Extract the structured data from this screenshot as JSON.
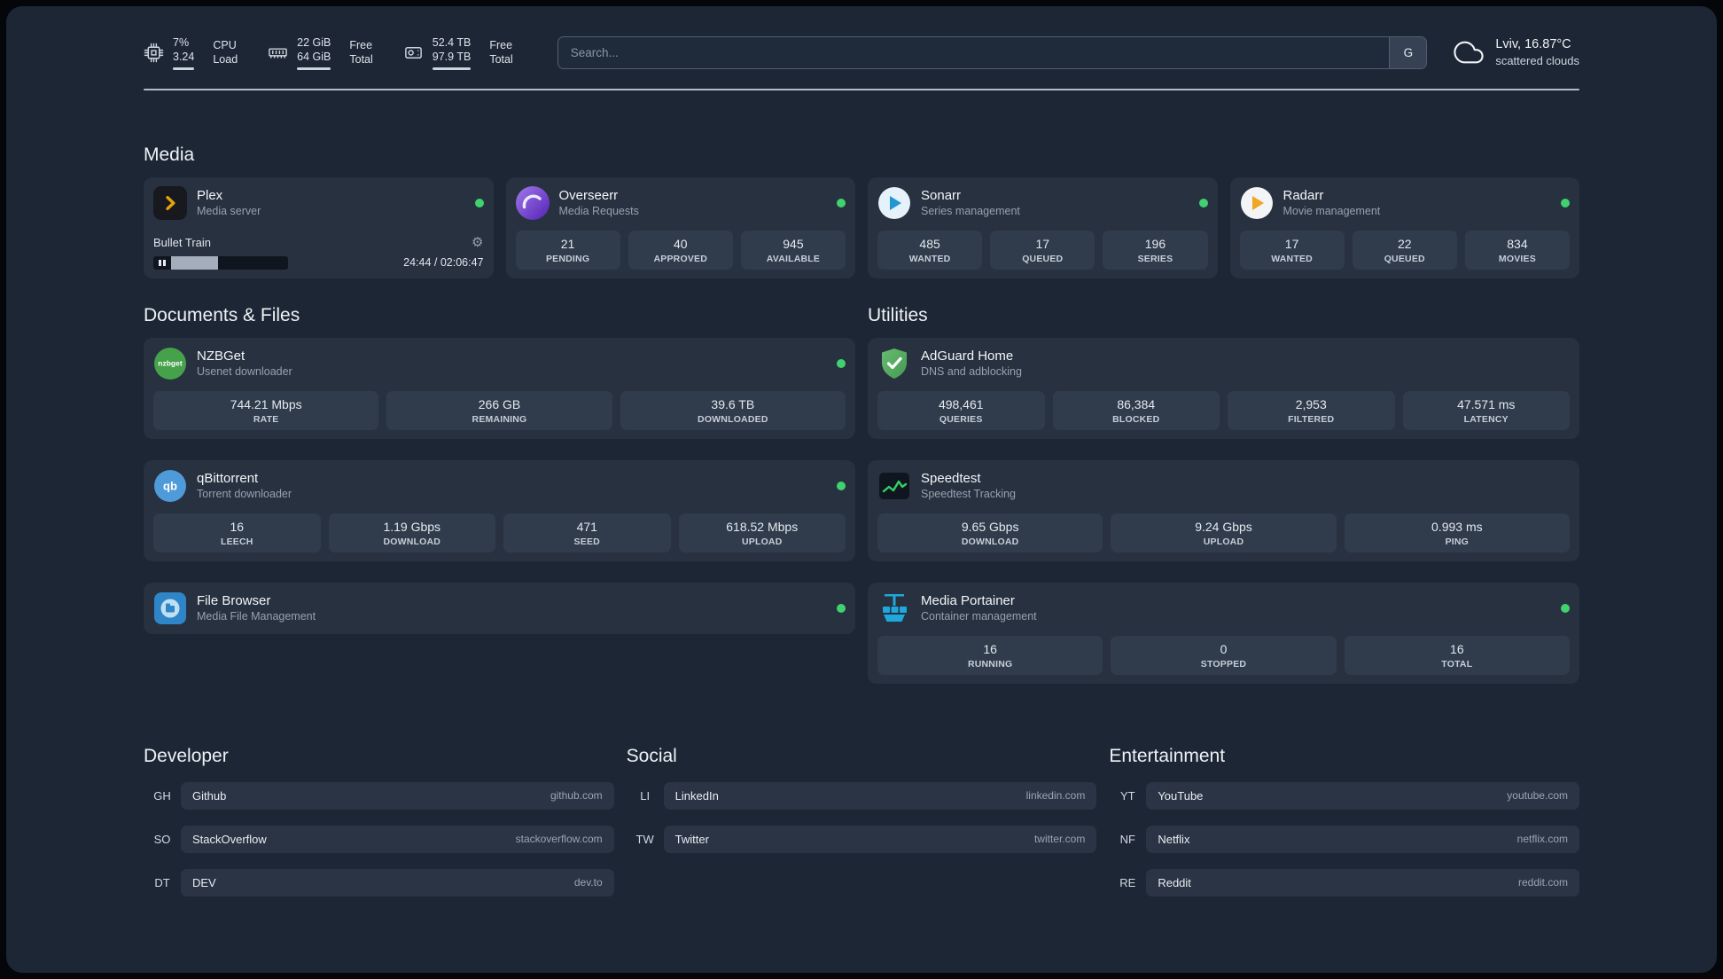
{
  "icons": {
    "gear": "⚙",
    "nzbget_logo_text": "nzbget",
    "qbittorrent_logo_text": "qb"
  },
  "topbar": {
    "cpu": {
      "percent": "7%",
      "load": "3.24",
      "label_top": "CPU",
      "label_bottom": "Load"
    },
    "memory": {
      "free": "22 GiB",
      "total": "64 GiB",
      "label_top": "Free",
      "label_bottom": "Total"
    },
    "disk": {
      "free": "52.4 TB",
      "total": "97.9 TB",
      "label_top": "Free",
      "label_bottom": "Total"
    },
    "search": {
      "placeholder": "Search...",
      "provider_label": "G"
    },
    "weather": {
      "location": "Lviv, 16.87°C",
      "condition": "scattered clouds"
    }
  },
  "sections": {
    "media": "Media",
    "documents": "Documents & Files",
    "utilities": "Utilities",
    "developer": "Developer",
    "social": "Social",
    "entertainment": "Entertainment"
  },
  "services": {
    "plex": {
      "name": "Plex",
      "description": "Media server",
      "now_playing": "Bullet Train",
      "time": "24:44 / 02:06:47"
    },
    "overseerr": {
      "name": "Overseerr",
      "description": "Media Requests",
      "stats": [
        {
          "value": "21",
          "label": "PENDING"
        },
        {
          "value": "40",
          "label": "APPROVED"
        },
        {
          "value": "945",
          "label": "AVAILABLE"
        }
      ]
    },
    "sonarr": {
      "name": "Sonarr",
      "description": "Series management",
      "stats": [
        {
          "value": "485",
          "label": "WANTED"
        },
        {
          "value": "17",
          "label": "QUEUED"
        },
        {
          "value": "196",
          "label": "SERIES"
        }
      ]
    },
    "radarr": {
      "name": "Radarr",
      "description": "Movie management",
      "stats": [
        {
          "value": "17",
          "label": "WANTED"
        },
        {
          "value": "22",
          "label": "QUEUED"
        },
        {
          "value": "834",
          "label": "MOVIES"
        }
      ]
    },
    "nzbget": {
      "name": "NZBGet",
      "description": "Usenet downloader",
      "stats": [
        {
          "value": "744.21 Mbps",
          "label": "RATE"
        },
        {
          "value": "266 GB",
          "label": "REMAINING"
        },
        {
          "value": "39.6 TB",
          "label": "DOWNLOADED"
        }
      ]
    },
    "qbittorrent": {
      "name": "qBittorrent",
      "description": "Torrent downloader",
      "stats": [
        {
          "value": "16",
          "label": "LEECH"
        },
        {
          "value": "1.19 Gbps",
          "label": "DOWNLOAD"
        },
        {
          "value": "471",
          "label": "SEED"
        },
        {
          "value": "618.52 Mbps",
          "label": "UPLOAD"
        }
      ]
    },
    "filebrowser": {
      "name": "File Browser",
      "description": "Media File Management"
    },
    "adguard": {
      "name": "AdGuard Home",
      "description": "DNS and adblocking",
      "stats": [
        {
          "value": "498,461",
          "label": "QUERIES"
        },
        {
          "value": "86,384",
          "label": "BLOCKED"
        },
        {
          "value": "2,953",
          "label": "FILTERED"
        },
        {
          "value": "47.571 ms",
          "label": "LATENCY"
        }
      ]
    },
    "speedtest": {
      "name": "Speedtest",
      "description": "Speedtest Tracking",
      "stats": [
        {
          "value": "9.65 Gbps",
          "label": "DOWNLOAD"
        },
        {
          "value": "9.24 Gbps",
          "label": "UPLOAD"
        },
        {
          "value": "0.993 ms",
          "label": "PING"
        }
      ]
    },
    "portainer": {
      "name": "Media Portainer",
      "description": "Container management",
      "stats": [
        {
          "value": "16",
          "label": "RUNNING"
        },
        {
          "value": "0",
          "label": "STOPPED"
        },
        {
          "value": "16",
          "label": "TOTAL"
        }
      ]
    }
  },
  "bookmarks": {
    "developer": [
      {
        "abbr": "GH",
        "name": "Github",
        "url": "github.com"
      },
      {
        "abbr": "SO",
        "name": "StackOverflow",
        "url": "stackoverflow.com"
      },
      {
        "abbr": "DT",
        "name": "DEV",
        "url": "dev.to"
      }
    ],
    "social": [
      {
        "abbr": "LI",
        "name": "LinkedIn",
        "url": "linkedin.com"
      },
      {
        "abbr": "TW",
        "name": "Twitter",
        "url": "twitter.com"
      }
    ],
    "entertainment": [
      {
        "abbr": "YT",
        "name": "YouTube",
        "url": "youtube.com"
      },
      {
        "abbr": "NF",
        "name": "Netflix",
        "url": "netflix.com"
      },
      {
        "abbr": "RE",
        "name": "Reddit",
        "url": "reddit.com"
      }
    ]
  }
}
